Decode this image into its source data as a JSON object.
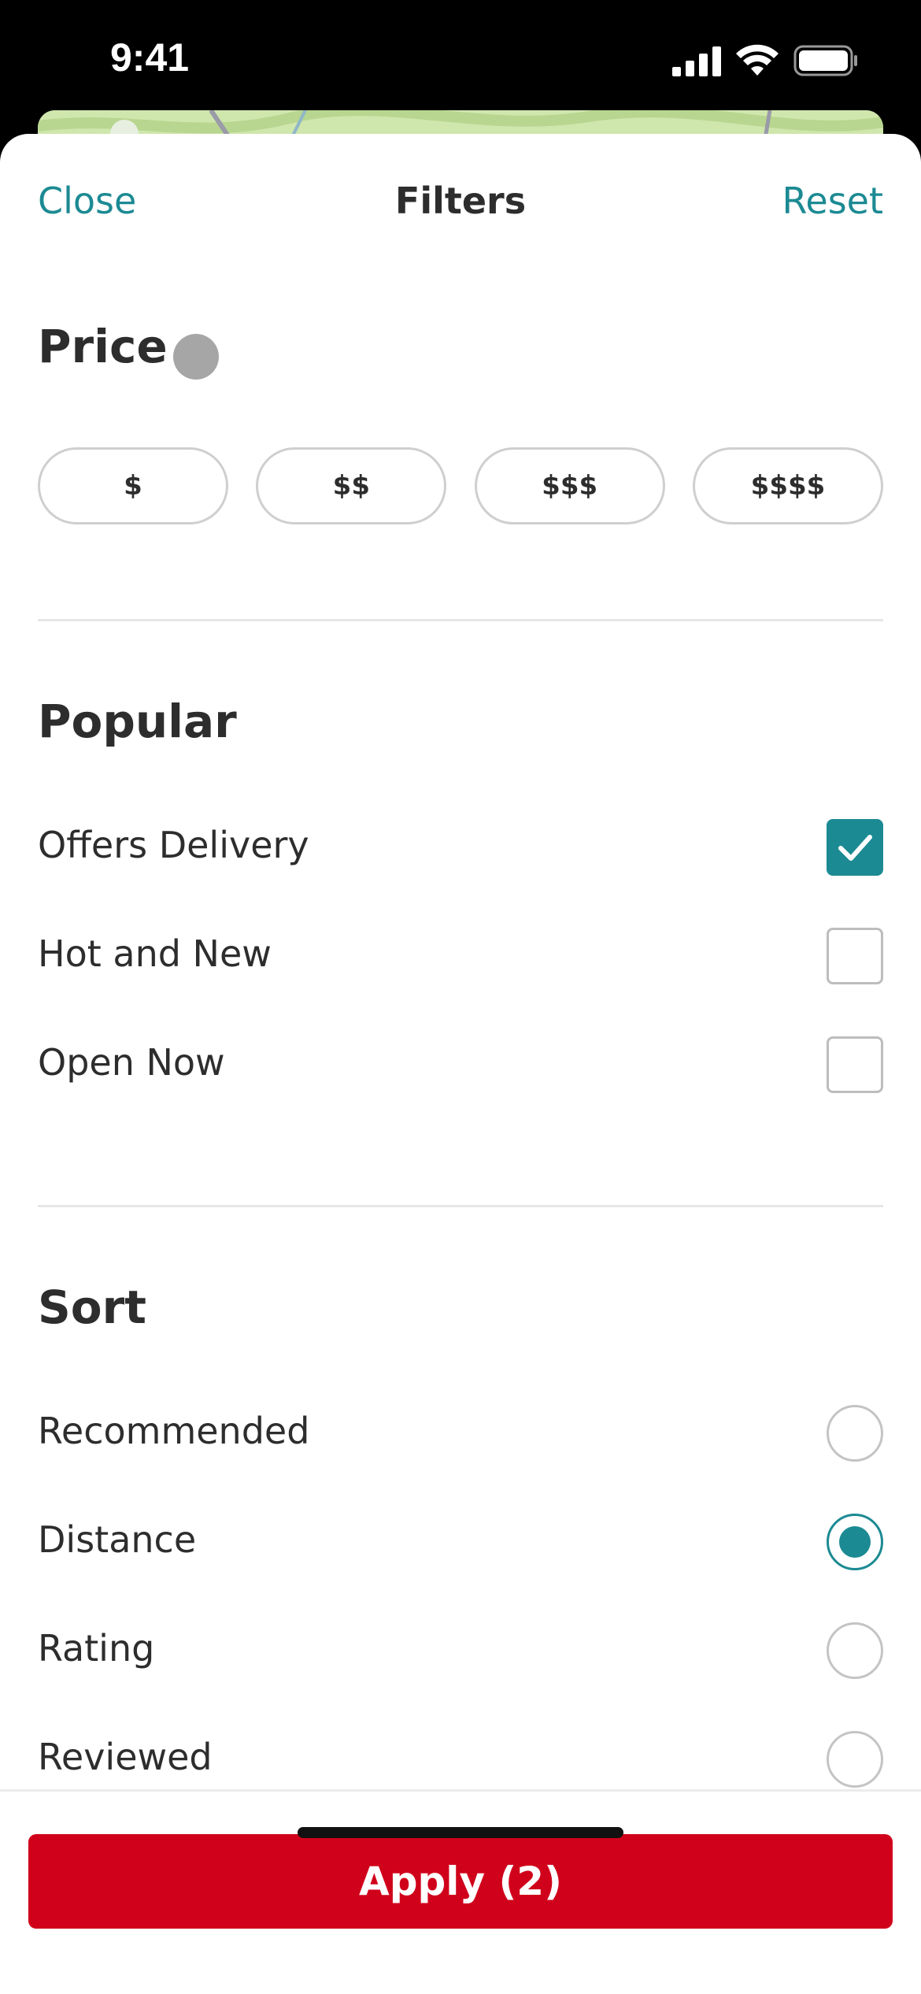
{
  "status_bar": {
    "time": "9:41"
  },
  "nav": {
    "close_label": "Close",
    "title": "Filters",
    "reset_label": "Reset"
  },
  "price": {
    "title": "Price",
    "options": [
      "$",
      "$$",
      "$$$",
      "$$$$"
    ]
  },
  "popular": {
    "title": "Popular",
    "options": [
      {
        "label": "Offers Delivery",
        "checked": true
      },
      {
        "label": "Hot and New",
        "checked": false
      },
      {
        "label": "Open Now",
        "checked": false
      }
    ]
  },
  "sort": {
    "title": "Sort",
    "selected": "Distance",
    "options": [
      "Recommended",
      "Distance",
      "Rating",
      "Reviewed"
    ]
  },
  "apply": {
    "label": "Apply (2)"
  },
  "colors": {
    "accent": "#1c8a93",
    "apply_button": "#d0021b",
    "text": "#2d2d2d",
    "price_dot": "#a6a6a6"
  },
  "icons": {
    "signal": "cellular-signal-icon",
    "wifi": "wifi-icon",
    "battery": "battery-icon",
    "checkmark": "checkmark-icon"
  }
}
